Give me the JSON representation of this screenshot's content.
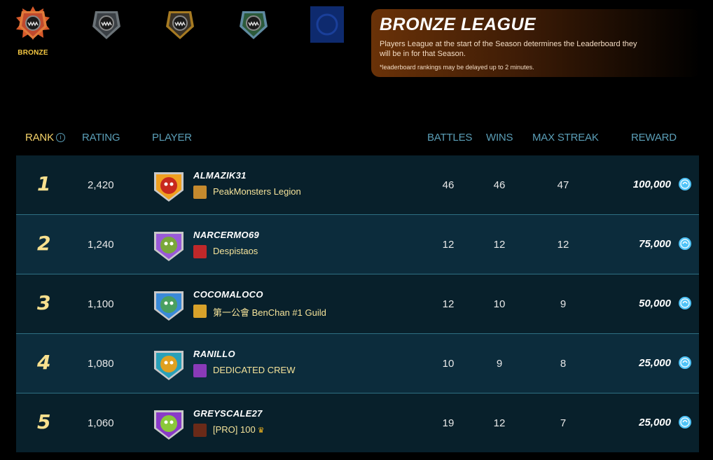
{
  "leagues": [
    {
      "name": "bronze",
      "label": "BRONZE",
      "color": "#c0492d",
      "rim": "#e07a3a",
      "active": true
    },
    {
      "name": "silver",
      "label": "",
      "color": "#3a3f44",
      "rim": "#6b7378",
      "active": false
    },
    {
      "name": "gold",
      "label": "",
      "color": "#3a3226",
      "rim": "#a67a22",
      "active": false
    },
    {
      "name": "diamond",
      "label": "",
      "color": "#2c5a3a",
      "rim": "#5f8aa0",
      "active": false
    },
    {
      "name": "champion",
      "label": "",
      "color": "#0e2a6e",
      "rim": "#1a3f9a",
      "active": false
    }
  ],
  "panel": {
    "title": "BRONZE LEAGUE",
    "text": "Players League at the start of the Season determines the Leaderboard they will be in for that Season.",
    "note": "*leaderboard rankings may be delayed up to 2 minutes."
  },
  "headers": {
    "rank": "RANK",
    "rating": "RATING",
    "player": "PLAYER",
    "battles": "BATTLES",
    "wins": "WINS",
    "max_streak": "MAX STREAK",
    "reward": "REWARD"
  },
  "rows": [
    {
      "rank": "1",
      "rating": "2,420",
      "player": "ALMAZIK31",
      "guild": "PeakMonsters Legion",
      "guild_crown": "",
      "battles": "46",
      "wins": "46",
      "max_streak": "47",
      "reward": "100,000",
      "avatar_bg": "#f0a020",
      "avatar_fg": "#c8281e",
      "guild_bg": "#c58a2e"
    },
    {
      "rank": "2",
      "rating": "1,240",
      "player": "NARCERMO69",
      "guild": "Despistaos",
      "guild_crown": "",
      "battles": "12",
      "wins": "12",
      "max_streak": "12",
      "reward": "75,000",
      "avatar_bg": "#9a5ad8",
      "avatar_fg": "#7aa83a",
      "guild_bg": "#c0282a"
    },
    {
      "rank": "3",
      "rating": "1,100",
      "player": "COCOMALOCO",
      "guild": "第一公會 BenChan #1 Guild",
      "guild_crown": "",
      "battles": "12",
      "wins": "10",
      "max_streak": "9",
      "reward": "50,000",
      "avatar_bg": "#3a8ad8",
      "avatar_fg": "#4aa060",
      "guild_bg": "#d8a22a"
    },
    {
      "rank": "4",
      "rating": "1,080",
      "player": "RANILLO",
      "guild": "DEDICATED CREW",
      "guild_crown": "",
      "battles": "10",
      "wins": "9",
      "max_streak": "8",
      "reward": "25,000",
      "avatar_bg": "#2aa0b8",
      "avatar_fg": "#e0a020",
      "guild_bg": "#8a3ab8"
    },
    {
      "rank": "5",
      "rating": "1,060",
      "player": "GREYSCALE27",
      "guild": "[PRO] 100",
      "guild_crown": "♛",
      "battles": "19",
      "wins": "12",
      "max_streak": "7",
      "reward": "25,000",
      "avatar_bg": "#8a3ac8",
      "avatar_fg": "#8ac83a",
      "guild_bg": "#6a2a18"
    }
  ],
  "colors": {
    "accent_rank": "#f8e08e",
    "header": "#5b9fb8",
    "coin": "#4fc3f7"
  }
}
